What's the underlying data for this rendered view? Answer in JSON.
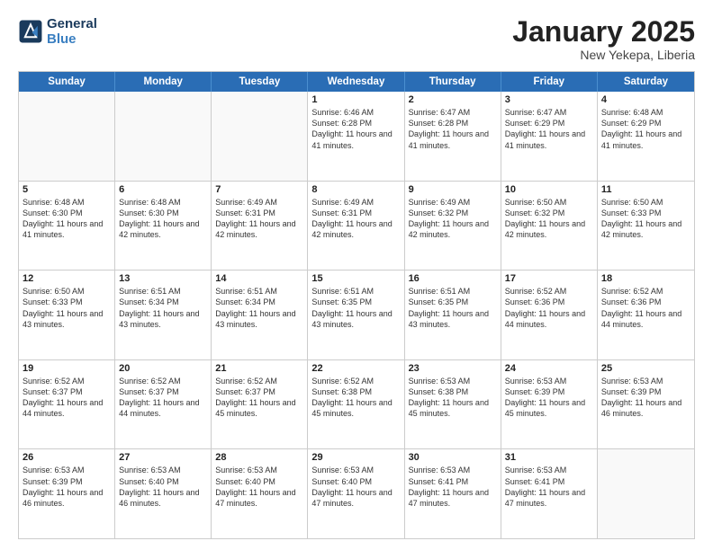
{
  "header": {
    "logo_line1": "General",
    "logo_line2": "Blue",
    "month_title": "January 2025",
    "location": "New Yekepa, Liberia"
  },
  "weekdays": [
    "Sunday",
    "Monday",
    "Tuesday",
    "Wednesday",
    "Thursday",
    "Friday",
    "Saturday"
  ],
  "rows": [
    [
      {
        "day": "",
        "empty": true
      },
      {
        "day": "",
        "empty": true
      },
      {
        "day": "",
        "empty": true
      },
      {
        "day": "1",
        "sunrise": "6:46 AM",
        "sunset": "6:28 PM",
        "daylight": "11 hours and 41 minutes."
      },
      {
        "day": "2",
        "sunrise": "6:47 AM",
        "sunset": "6:28 PM",
        "daylight": "11 hours and 41 minutes."
      },
      {
        "day": "3",
        "sunrise": "6:47 AM",
        "sunset": "6:29 PM",
        "daylight": "11 hours and 41 minutes."
      },
      {
        "day": "4",
        "sunrise": "6:48 AM",
        "sunset": "6:29 PM",
        "daylight": "11 hours and 41 minutes."
      }
    ],
    [
      {
        "day": "5",
        "sunrise": "6:48 AM",
        "sunset": "6:30 PM",
        "daylight": "11 hours and 41 minutes."
      },
      {
        "day": "6",
        "sunrise": "6:48 AM",
        "sunset": "6:30 PM",
        "daylight": "11 hours and 42 minutes."
      },
      {
        "day": "7",
        "sunrise": "6:49 AM",
        "sunset": "6:31 PM",
        "daylight": "11 hours and 42 minutes."
      },
      {
        "day": "8",
        "sunrise": "6:49 AM",
        "sunset": "6:31 PM",
        "daylight": "11 hours and 42 minutes."
      },
      {
        "day": "9",
        "sunrise": "6:49 AM",
        "sunset": "6:32 PM",
        "daylight": "11 hours and 42 minutes."
      },
      {
        "day": "10",
        "sunrise": "6:50 AM",
        "sunset": "6:32 PM",
        "daylight": "11 hours and 42 minutes."
      },
      {
        "day": "11",
        "sunrise": "6:50 AM",
        "sunset": "6:33 PM",
        "daylight": "11 hours and 42 minutes."
      }
    ],
    [
      {
        "day": "12",
        "sunrise": "6:50 AM",
        "sunset": "6:33 PM",
        "daylight": "11 hours and 43 minutes."
      },
      {
        "day": "13",
        "sunrise": "6:51 AM",
        "sunset": "6:34 PM",
        "daylight": "11 hours and 43 minutes."
      },
      {
        "day": "14",
        "sunrise": "6:51 AM",
        "sunset": "6:34 PM",
        "daylight": "11 hours and 43 minutes."
      },
      {
        "day": "15",
        "sunrise": "6:51 AM",
        "sunset": "6:35 PM",
        "daylight": "11 hours and 43 minutes."
      },
      {
        "day": "16",
        "sunrise": "6:51 AM",
        "sunset": "6:35 PM",
        "daylight": "11 hours and 43 minutes."
      },
      {
        "day": "17",
        "sunrise": "6:52 AM",
        "sunset": "6:36 PM",
        "daylight": "11 hours and 44 minutes."
      },
      {
        "day": "18",
        "sunrise": "6:52 AM",
        "sunset": "6:36 PM",
        "daylight": "11 hours and 44 minutes."
      }
    ],
    [
      {
        "day": "19",
        "sunrise": "6:52 AM",
        "sunset": "6:37 PM",
        "daylight": "11 hours and 44 minutes."
      },
      {
        "day": "20",
        "sunrise": "6:52 AM",
        "sunset": "6:37 PM",
        "daylight": "11 hours and 44 minutes."
      },
      {
        "day": "21",
        "sunrise": "6:52 AM",
        "sunset": "6:37 PM",
        "daylight": "11 hours and 45 minutes."
      },
      {
        "day": "22",
        "sunrise": "6:52 AM",
        "sunset": "6:38 PM",
        "daylight": "11 hours and 45 minutes."
      },
      {
        "day": "23",
        "sunrise": "6:53 AM",
        "sunset": "6:38 PM",
        "daylight": "11 hours and 45 minutes."
      },
      {
        "day": "24",
        "sunrise": "6:53 AM",
        "sunset": "6:39 PM",
        "daylight": "11 hours and 45 minutes."
      },
      {
        "day": "25",
        "sunrise": "6:53 AM",
        "sunset": "6:39 PM",
        "daylight": "11 hours and 46 minutes."
      }
    ],
    [
      {
        "day": "26",
        "sunrise": "6:53 AM",
        "sunset": "6:39 PM",
        "daylight": "11 hours and 46 minutes."
      },
      {
        "day": "27",
        "sunrise": "6:53 AM",
        "sunset": "6:40 PM",
        "daylight": "11 hours and 46 minutes."
      },
      {
        "day": "28",
        "sunrise": "6:53 AM",
        "sunset": "6:40 PM",
        "daylight": "11 hours and 47 minutes."
      },
      {
        "day": "29",
        "sunrise": "6:53 AM",
        "sunset": "6:40 PM",
        "daylight": "11 hours and 47 minutes."
      },
      {
        "day": "30",
        "sunrise": "6:53 AM",
        "sunset": "6:41 PM",
        "daylight": "11 hours and 47 minutes."
      },
      {
        "day": "31",
        "sunrise": "6:53 AM",
        "sunset": "6:41 PM",
        "daylight": "11 hours and 47 minutes."
      },
      {
        "day": "",
        "empty": true
      }
    ]
  ]
}
